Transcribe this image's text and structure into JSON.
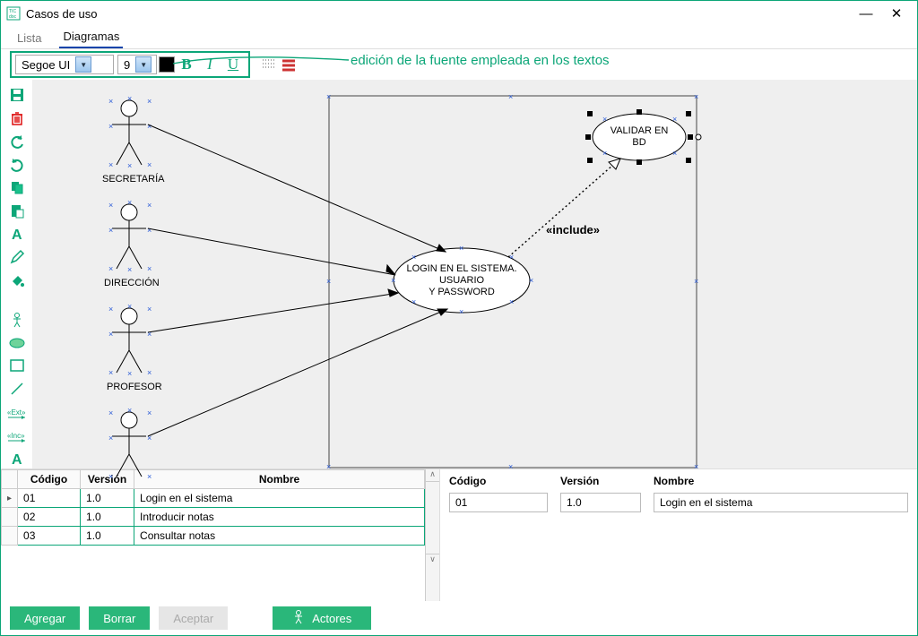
{
  "window": {
    "title": "Casos de uso",
    "min_label": "—",
    "close_label": "✕"
  },
  "tabs": {
    "lista": "Lista",
    "diagramas": "Diagramas"
  },
  "font_toolbar": {
    "font_name": "Segoe UI",
    "font_size": "9",
    "bold": "B",
    "italic": "I",
    "underline": "U",
    "color": "#000000"
  },
  "annotation": "edición de la fuente empleada en los textos",
  "toolbar_icons": [
    "save-icon",
    "delete-icon",
    "undo-icon",
    "redo-icon",
    "copy-icon",
    "paste-icon",
    "text-mode-icon",
    "edit-icon",
    "fill-icon",
    "actor-tool-icon",
    "usecase-tool-icon",
    "rect-tool-icon",
    "line-tool-icon",
    "extend-tool-icon",
    "include-tool-icon",
    "text-tool-icon"
  ],
  "diagram": {
    "actors": [
      {
        "name": "SECRETARÍA"
      },
      {
        "name": "DIRECCIÓN"
      },
      {
        "name": "PROFESOR"
      }
    ],
    "usecases": {
      "login": {
        "line1": "LOGIN EN EL SISTEMA.",
        "line2": "USUARIO",
        "line3": "Y PASSWORD"
      },
      "validar": {
        "line1": "VALIDAR EN",
        "line2": "BD"
      }
    },
    "include_label": "«include»"
  },
  "grid": {
    "headers": {
      "codigo": "Código",
      "version": "Versión",
      "nombre": "Nombre"
    },
    "rows": [
      {
        "codigo": "01",
        "version": "1.0",
        "nombre": "Login en el sistema"
      },
      {
        "codigo": "02",
        "version": "1.0",
        "nombre": "Introducir notas"
      },
      {
        "codigo": "03",
        "version": "1.0",
        "nombre": "Consultar notas"
      }
    ]
  },
  "detail": {
    "labels": {
      "codigo": "Código",
      "version": "Versión",
      "nombre": "Nombre"
    },
    "values": {
      "codigo": "01",
      "version": "1.0",
      "nombre": "Login en el sistema"
    }
  },
  "footer": {
    "agregar": "Agregar",
    "borrar": "Borrar",
    "aceptar": "Aceptar",
    "actores": "Actores"
  },
  "colors": {
    "accent": "#0ca678",
    "btn": "#2ab77a"
  }
}
